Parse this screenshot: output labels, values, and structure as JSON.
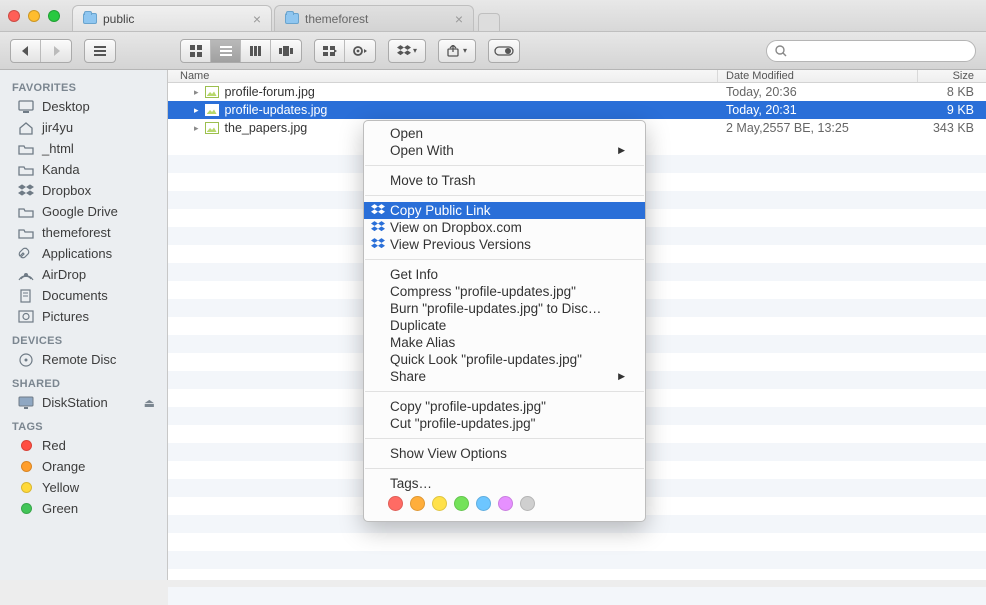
{
  "tabs": [
    {
      "label": "public",
      "active": true
    },
    {
      "label": "themeforest",
      "active": false
    }
  ],
  "search": {
    "placeholder": ""
  },
  "sidebar": {
    "sections": [
      {
        "title": "FAVORITES",
        "items": [
          {
            "label": "Desktop",
            "icon": "desktop-icon"
          },
          {
            "label": "jir4yu",
            "icon": "home-icon"
          },
          {
            "label": "_html",
            "icon": "folder-icon"
          },
          {
            "label": "Kanda",
            "icon": "folder-icon"
          },
          {
            "label": "Dropbox",
            "icon": "dropbox-icon"
          },
          {
            "label": "Google Drive",
            "icon": "folder-icon"
          },
          {
            "label": "themeforest",
            "icon": "folder-icon"
          },
          {
            "label": "Applications",
            "icon": "applications-icon"
          },
          {
            "label": "AirDrop",
            "icon": "airdrop-icon"
          },
          {
            "label": "Documents",
            "icon": "documents-icon"
          },
          {
            "label": "Pictures",
            "icon": "pictures-icon"
          }
        ]
      },
      {
        "title": "DEVICES",
        "items": [
          {
            "label": "Remote Disc",
            "icon": "disc-icon"
          }
        ]
      },
      {
        "title": "SHARED",
        "items": [
          {
            "label": "DiskStation",
            "icon": "serverscreen-icon",
            "eject": true
          }
        ]
      },
      {
        "title": "TAGS",
        "items": [
          {
            "label": "Red",
            "tag": "#ff4e42"
          },
          {
            "label": "Orange",
            "tag": "#ff9e2c"
          },
          {
            "label": "Yellow",
            "tag": "#ffd93a"
          },
          {
            "label": "Green",
            "tag": "#42c558"
          }
        ]
      }
    ]
  },
  "columns": {
    "name": "Name",
    "date": "Date Modified",
    "size": "Size"
  },
  "rows": [
    {
      "name": "profile-forum.jpg",
      "date": "Today, 20:36",
      "size": "8 KB",
      "selected": false
    },
    {
      "name": "profile-updates.jpg",
      "date": "Today, 20:31",
      "size": "9 KB",
      "selected": true
    },
    {
      "name": "the_papers.jpg",
      "date": "2 May,2557 BE, 13:25",
      "size": "343 KB",
      "selected": false
    }
  ],
  "context_menu": {
    "items": [
      {
        "label": "Open"
      },
      {
        "label": "Open With",
        "submenu": true
      },
      {
        "sep": true
      },
      {
        "label": "Move to Trash"
      },
      {
        "sep": true
      },
      {
        "label": "Copy Public Link",
        "dbx": true,
        "selected": true
      },
      {
        "label": "View on Dropbox.com",
        "dbx": true
      },
      {
        "label": "View Previous Versions",
        "dbx": true
      },
      {
        "sep": true
      },
      {
        "label": "Get Info"
      },
      {
        "label": "Compress \"profile-updates.jpg\""
      },
      {
        "label": "Burn \"profile-updates.jpg\" to Disc…"
      },
      {
        "label": "Duplicate"
      },
      {
        "label": "Make Alias"
      },
      {
        "label": "Quick Look \"profile-updates.jpg\""
      },
      {
        "label": "Share",
        "submenu": true
      },
      {
        "sep": true
      },
      {
        "label": "Copy \"profile-updates.jpg\""
      },
      {
        "label": "Cut \"profile-updates.jpg\""
      },
      {
        "sep": true
      },
      {
        "label": "Show View Options"
      },
      {
        "sep": true
      },
      {
        "label": "Tags…"
      }
    ],
    "tag_colors": [
      "#ff6b64",
      "#ffae3b",
      "#ffe14a",
      "#74e25a",
      "#6dc6ff",
      "#e690ff",
      "#cfcfcf"
    ]
  }
}
